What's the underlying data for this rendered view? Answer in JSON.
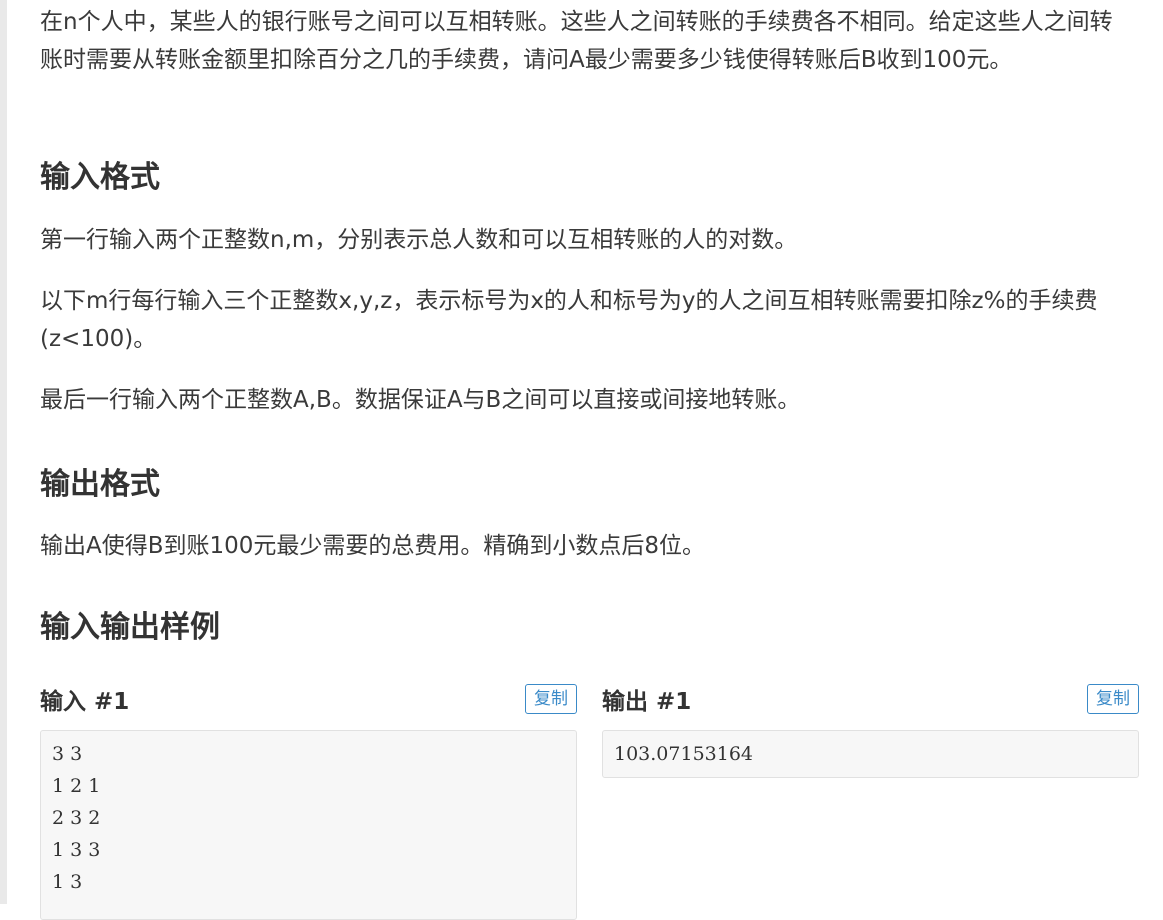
{
  "problem": {
    "description": "在n个人中，某些人的银行账号之间可以互相转账。这些人之间转账的手续费各不相同。给定这些人之间转账时需要从转账金额里扣除百分之几的手续费，请问A最少需要多少钱使得转账后B收到100元。",
    "input_format": {
      "title": "输入格式",
      "paragraphs": [
        "第一行输入两个正整数n,m，分别表示总人数和可以互相转账的人的对数。",
        "以下m行每行输入三个正整数x,y,z，表示标号为x的人和标号为y的人之间互相转账需要扣除z%的手续费 (z<100)。",
        "最后一行输入两个正整数A,B。数据保证A与B之间可以直接或间接地转账。"
      ]
    },
    "output_format": {
      "title": "输出格式",
      "paragraphs": [
        "输出A使得B到账100元最少需要的总费用。精确到小数点后8位。"
      ]
    },
    "samples": {
      "title": "输入输出样例",
      "input": {
        "label": "输入 #1",
        "copy_label": "复制",
        "lines": [
          "3 3",
          "1 2 1",
          "2 3 2",
          "1 3 3",
          "1 3"
        ]
      },
      "output": {
        "label": "输出 #1",
        "copy_label": "复制",
        "lines": [
          "103.07153164"
        ]
      }
    }
  }
}
